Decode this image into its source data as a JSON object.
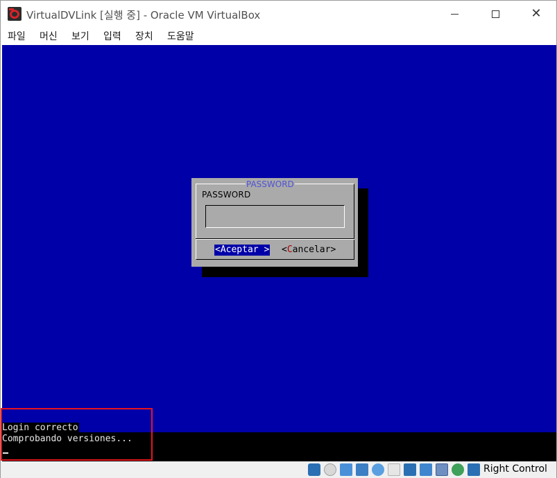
{
  "window": {
    "title": "VirtualDVLink [실행 중] - Oracle VM VirtualBox",
    "controls": {
      "minimize": "—",
      "maximize": "☐",
      "close": "✕"
    }
  },
  "menu": {
    "items": [
      "파일",
      "머신",
      "보기",
      "입력",
      "장치",
      "도움말"
    ]
  },
  "dialog": {
    "title": "PASSWORD",
    "label": "PASSWORD",
    "password_value": "",
    "accept_label": "<Aceptar >",
    "cancel_label_open": "<",
    "cancel_label_hot": "C",
    "cancel_label_rest": "ancelar>"
  },
  "console": {
    "lines": [
      "Login correcto",
      "Comprobando versiones..."
    ],
    "cursor": "_"
  },
  "statusbar": {
    "icons": [
      "hard-disk-icon",
      "optical-drive-icon",
      "audio-icon",
      "network-icon",
      "usb-icon",
      "shared-folder-icon",
      "display-icon",
      "video-capture-icon",
      "virtualization-icon",
      "mouse-integration-icon",
      "keyboard-icon"
    ],
    "host_key_label": "Right Control"
  },
  "colors": {
    "vm_background": "#0000a8",
    "dialog_background": "#aaaaaa",
    "dialog_title": "#4f52d4",
    "annotation": "#e8141c"
  }
}
